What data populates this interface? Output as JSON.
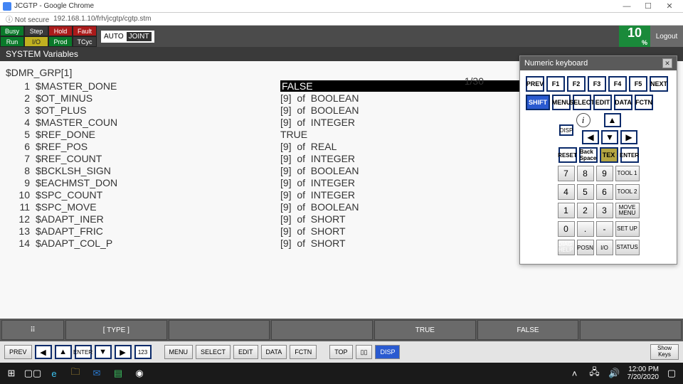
{
  "window": {
    "title": "JCGTP - Google Chrome",
    "security_label": "Not secure",
    "url": "192.168.1.10/frh/jcgtp/cgtp.stm"
  },
  "status": {
    "cells": [
      "Busy",
      "Step",
      "Hold",
      "Fault",
      "Run",
      "I/O",
      "Prod",
      "TCyc"
    ],
    "mode": "AUTO",
    "frame": "JOINT",
    "speed": "10",
    "speed_unit": "%",
    "logout": "Logout"
  },
  "section_title": "SYSTEM Variables",
  "group_title": "$DMR_GRP[1]",
  "page_indicator": "1/30",
  "vars": [
    {
      "n": "1",
      "name": "$MASTER_DONE",
      "val": "FALSE",
      "sel": true
    },
    {
      "n": "2",
      "name": "$OT_MINUS",
      "val": "[9]  of  BOOLEAN"
    },
    {
      "n": "3",
      "name": "$OT_PLUS",
      "val": "[9]  of  BOOLEAN"
    },
    {
      "n": "4",
      "name": "$MASTER_COUN",
      "val": "[9]  of  INTEGER"
    },
    {
      "n": "5",
      "name": "$REF_DONE",
      "val": "TRUE"
    },
    {
      "n": "6",
      "name": "$REF_POS",
      "val": "[9]  of  REAL"
    },
    {
      "n": "7",
      "name": "$REF_COUNT",
      "val": "[9]  of  INTEGER"
    },
    {
      "n": "8",
      "name": "$BCKLSH_SIGN",
      "val": "[9]  of  BOOLEAN"
    },
    {
      "n": "9",
      "name": "$EACHMST_DON",
      "val": "[9]  of  INTEGER"
    },
    {
      "n": "10",
      "name": "$SPC_COUNT",
      "val": "[9]  of  INTEGER"
    },
    {
      "n": "11",
      "name": "$SPC_MOVE",
      "val": "[9]  of  BOOLEAN"
    },
    {
      "n": "12",
      "name": "$ADAPT_INER",
      "val": "[9]  of  SHORT"
    },
    {
      "n": "13",
      "name": "$ADAPT_FRIC",
      "val": "[9]  of  SHORT"
    },
    {
      "n": "14",
      "name": "$ADAPT_COL_P",
      "val": "[9]  of  SHORT"
    }
  ],
  "numkb": {
    "title": "Numeric keyboard",
    "row1": [
      "PREV",
      "F1",
      "F2",
      "F3",
      "F4",
      "F5",
      "NEXT"
    ],
    "row2": [
      "SHIFT",
      "MENU",
      "SELECT",
      "EDIT",
      "DATA",
      "FCTN"
    ],
    "row3_labels": {
      "disp": "DISP",
      "reset": "RESET",
      "backspace": "Back Space",
      "tex": "TEX",
      "enter": "ENTER"
    },
    "tools": [
      "TOOL 1",
      "TOOL 2",
      "MOVE MENU",
      "SET UP",
      "STATUS"
    ],
    "posn": "POSN",
    "io": "I/O",
    "diag": "DIAG HELP",
    "nums": [
      "7",
      "8",
      "9",
      "4",
      "5",
      "6",
      "1",
      "2",
      "3",
      "0",
      ".",
      "-"
    ]
  },
  "tb1": {
    "type": "[ TYPE ]",
    "true": "TRUE",
    "false": "FALSE"
  },
  "tb2": {
    "prev": "PREV",
    "menu": "MENU",
    "select": "SELECT",
    "edit": "EDIT",
    "data": "DATA",
    "fctn": "FCTN",
    "top": "TOP",
    "disp": "DISP",
    "showkeys": "Show Keys"
  },
  "taskbar": {
    "time": "12:00 PM",
    "date": "7/20/2020"
  }
}
